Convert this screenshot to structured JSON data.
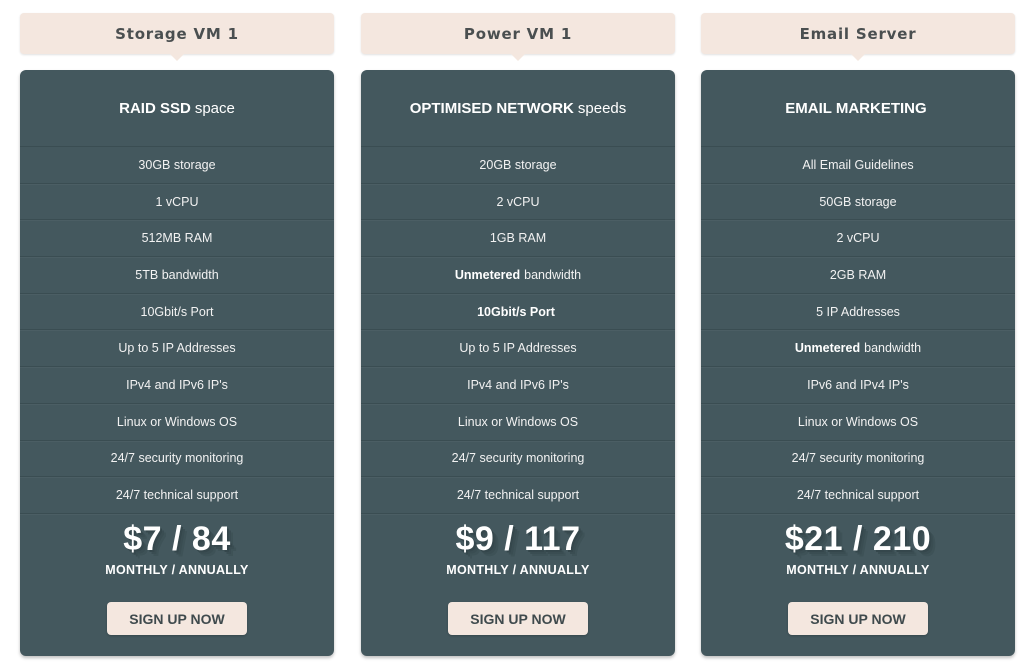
{
  "colors": {
    "card_bg": "#44585e",
    "tab_bg": "#f4e7df",
    "tab_text": "#4a4f50",
    "button_bg": "#f4e7df",
    "button_text": "#3f4a4d",
    "card_text": "#ffffff"
  },
  "plans": [
    {
      "name": "Storage VM 1",
      "headline_bold": "RAID SSD",
      "headline_rest": "space",
      "features": [
        {
          "bold": "",
          "text": "30GB storage"
        },
        {
          "bold": "",
          "text": "1 vCPU"
        },
        {
          "bold": "",
          "text": "512MB RAM"
        },
        {
          "bold": "",
          "text": "5TB bandwidth"
        },
        {
          "bold": "",
          "text": "10Gbit/s Port"
        },
        {
          "bold": "",
          "text": "Up to 5 IP Addresses"
        },
        {
          "bold": "",
          "text": "IPv4 and IPv6 IP's"
        },
        {
          "bold": "",
          "text": "Linux or Windows OS"
        },
        {
          "bold": "",
          "text": "24/7 security monitoring"
        },
        {
          "bold": "",
          "text": "24/7 technical support"
        }
      ],
      "price": "$7 / 84",
      "period": "MONTHLY / ANNUALLY",
      "cta": "SIGN UP NOW"
    },
    {
      "name": "Power VM 1",
      "headline_bold": "OPTIMISED NETWORK",
      "headline_rest": "speeds",
      "features": [
        {
          "bold": "",
          "text": "20GB storage"
        },
        {
          "bold": "",
          "text": "2 vCPU"
        },
        {
          "bold": "",
          "text": "1GB RAM"
        },
        {
          "bold": "Unmetered",
          "text": "bandwidth"
        },
        {
          "bold": "10Gbit/s Port",
          "text": ""
        },
        {
          "bold": "",
          "text": "Up to 5 IP Addresses"
        },
        {
          "bold": "",
          "text": "IPv4 and IPv6 IP's"
        },
        {
          "bold": "",
          "text": "Linux or Windows OS"
        },
        {
          "bold": "",
          "text": "24/7 security monitoring"
        },
        {
          "bold": "",
          "text": "24/7 technical support"
        }
      ],
      "price": "$9 / 117",
      "period": "MONTHLY / ANNUALLY",
      "cta": "SIGN UP NOW"
    },
    {
      "name": "Email Server",
      "headline_bold": "EMAIL MARKETING",
      "headline_rest": "",
      "features": [
        {
          "bold": "",
          "text": "All Email Guidelines"
        },
        {
          "bold": "",
          "text": "50GB storage"
        },
        {
          "bold": "",
          "text": "2 vCPU"
        },
        {
          "bold": "",
          "text": "2GB RAM"
        },
        {
          "bold": "",
          "text": "5 IP Addresses"
        },
        {
          "bold": "Unmetered",
          "text": "bandwidth"
        },
        {
          "bold": "",
          "text": "IPv6 and IPv4 IP's"
        },
        {
          "bold": "",
          "text": "Linux or Windows OS"
        },
        {
          "bold": "",
          "text": "24/7 security monitoring"
        },
        {
          "bold": "",
          "text": "24/7 technical support"
        }
      ],
      "price": "$21 / 210",
      "period": "MONTHLY / ANNUALLY",
      "cta": "SIGN UP NOW"
    }
  ]
}
